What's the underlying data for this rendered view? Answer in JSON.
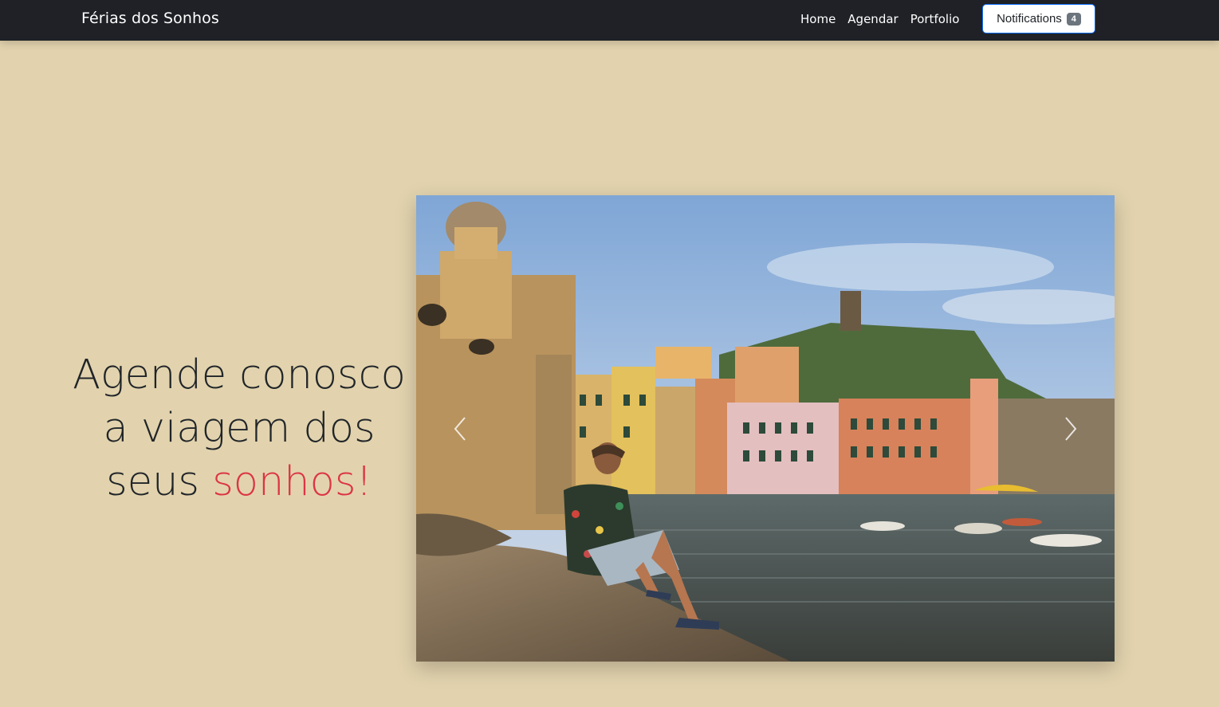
{
  "navbar": {
    "brand": "Férias dos Sonhos",
    "links": [
      "Home",
      "Agendar",
      "Portfolio"
    ],
    "notifications_label": "Notifications",
    "notifications_count": "4"
  },
  "hero": {
    "line1": "Agende conosco",
    "line2": "a viagem dos",
    "line3_plain": "seus",
    "line3_accent": "sonhos!"
  },
  "carousel": {
    "image_icon": "photo",
    "prev_icon": "chevron-left-icon",
    "next_icon": "chevron-right-icon"
  },
  "colors": {
    "page_background": "#e2d3ae",
    "navbar": "#1f2126",
    "accent": "#dc3545",
    "button_border": "#0d6efd",
    "badge": "#6c757d"
  }
}
